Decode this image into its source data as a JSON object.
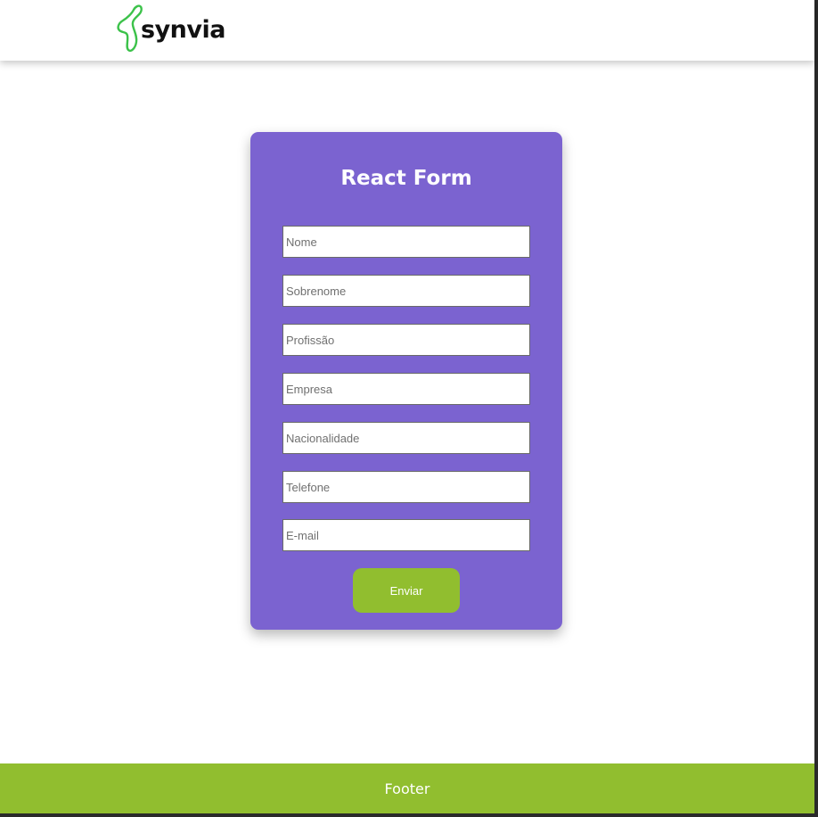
{
  "header": {
    "logo_text": "synvia",
    "logo_icon": "green-squiggle-logo-icon"
  },
  "form": {
    "title": "React Form",
    "fields": [
      {
        "placeholder": "Nome"
      },
      {
        "placeholder": "Sobrenome"
      },
      {
        "placeholder": "Profissão"
      },
      {
        "placeholder": "Empresa"
      },
      {
        "placeholder": "Nacionalidade"
      },
      {
        "placeholder": "Telefone"
      },
      {
        "placeholder": "E-mail"
      }
    ],
    "submit_label": "Enviar"
  },
  "footer": {
    "text": "Footer"
  },
  "colors": {
    "card_background": "#7b63d0",
    "accent_green": "#91be2f",
    "logo_green": "#3cc24a",
    "page_background": "#ffffff"
  }
}
